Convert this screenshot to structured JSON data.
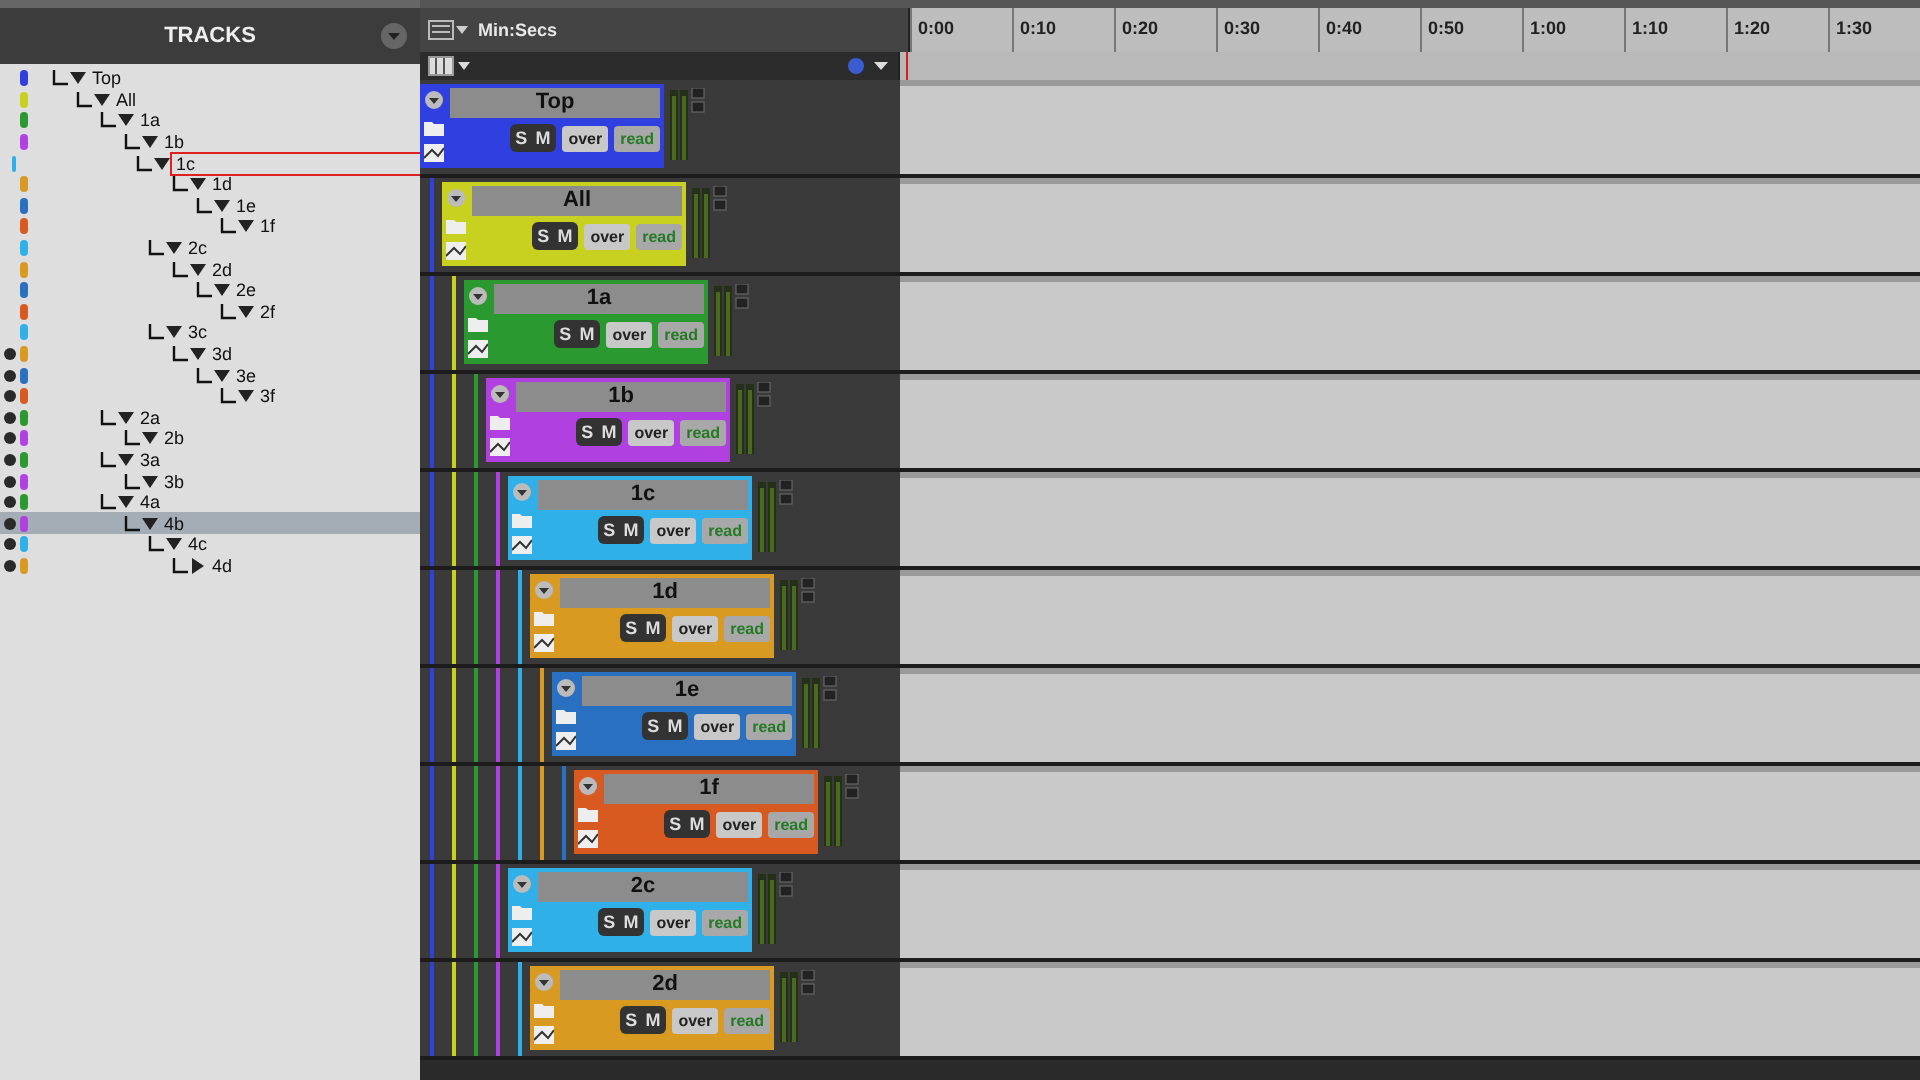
{
  "tracks_panel": {
    "title": "TRACKS",
    "tracks": [
      {
        "name": "Top",
        "color": "#3040e0",
        "shown": false,
        "expanded": true,
        "selected": false,
        "outlined": false,
        "children": [
          {
            "name": "All",
            "color": "#c8d020",
            "shown": false,
            "expanded": true,
            "selected": false,
            "outlined": false,
            "children": [
              {
                "name": "1a",
                "color": "#2a9a30",
                "shown": false,
                "expanded": true,
                "selected": false,
                "outlined": false,
                "children": [
                  {
                    "name": "1b",
                    "color": "#b040e0",
                    "shown": false,
                    "expanded": true,
                    "selected": false,
                    "outlined": false,
                    "children": [
                      {
                        "name": "1c",
                        "color": "#30b0e8",
                        "shown": false,
                        "expanded": true,
                        "selected": false,
                        "outlined": true,
                        "children": [
                          {
                            "name": "1d",
                            "color": "#d89a20",
                            "shown": false,
                            "expanded": true,
                            "selected": false,
                            "outlined": false,
                            "children": [
                              {
                                "name": "1e",
                                "color": "#2a70c0",
                                "shown": false,
                                "expanded": true,
                                "selected": false,
                                "outlined": false,
                                "children": [
                                  {
                                    "name": "1f",
                                    "color": "#d85a20",
                                    "shown": false,
                                    "expanded": true,
                                    "selected": false,
                                    "outlined": false
                                  }
                                ]
                              }
                            ]
                          }
                        ]
                      },
                      {
                        "name": "2c",
                        "color": "#30b0e8",
                        "shown": false,
                        "expanded": true,
                        "selected": false,
                        "outlined": false,
                        "children": [
                          {
                            "name": "2d",
                            "color": "#d89a20",
                            "shown": false,
                            "expanded": true,
                            "selected": false,
                            "outlined": false,
                            "children": [
                              {
                                "name": "2e",
                                "color": "#2a70c0",
                                "shown": false,
                                "expanded": true,
                                "selected": false,
                                "outlined": false,
                                "children": [
                                  {
                                    "name": "2f",
                                    "color": "#d85a20",
                                    "shown": false,
                                    "expanded": true,
                                    "selected": false,
                                    "outlined": false
                                  }
                                ]
                              }
                            ]
                          }
                        ]
                      },
                      {
                        "name": "3c",
                        "color": "#30b0e8",
                        "shown": false,
                        "expanded": true,
                        "selected": false,
                        "outlined": false,
                        "children": [
                          {
                            "name": "3d",
                            "color": "#d89a20",
                            "shown": true,
                            "expanded": true,
                            "selected": false,
                            "outlined": false,
                            "children": [
                              {
                                "name": "3e",
                                "color": "#2a70c0",
                                "shown": true,
                                "expanded": true,
                                "selected": false,
                                "outlined": false,
                                "children": [
                                  {
                                    "name": "3f",
                                    "color": "#d85a20",
                                    "shown": true,
                                    "expanded": true,
                                    "selected": false,
                                    "outlined": false
                                  }
                                ]
                              }
                            ]
                          }
                        ]
                      }
                    ]
                  }
                ]
              },
              {
                "name": "2a",
                "color": "#2a9a30",
                "shown": true,
                "expanded": true,
                "selected": false,
                "outlined": false,
                "children": [
                  {
                    "name": "2b",
                    "color": "#b040e0",
                    "shown": true,
                    "expanded": true,
                    "selected": false,
                    "outlined": false
                  }
                ]
              },
              {
                "name": "3a",
                "color": "#2a9a30",
                "shown": true,
                "expanded": true,
                "selected": false,
                "outlined": false,
                "children": [
                  {
                    "name": "3b",
                    "color": "#b040e0",
                    "shown": true,
                    "expanded": true,
                    "selected": false,
                    "outlined": false
                  }
                ]
              },
              {
                "name": "4a",
                "color": "#2a9a30",
                "shown": true,
                "expanded": true,
                "selected": false,
                "outlined": false,
                "children": [
                  {
                    "name": "4b",
                    "color": "#b040e0",
                    "shown": true,
                    "expanded": true,
                    "selected": true,
                    "outlined": false,
                    "children": [
                      {
                        "name": "4c",
                        "color": "#30b0e8",
                        "shown": true,
                        "expanded": true,
                        "selected": false,
                        "outlined": false,
                        "children": [
                          {
                            "name": "4d",
                            "color": "#d89a20",
                            "shown": true,
                            "expanded": false,
                            "selected": false,
                            "outlined": false
                          }
                        ]
                      }
                    ]
                  }
                ]
              }
            ]
          }
        ]
      }
    ]
  },
  "ruler": {
    "timebase": "Min:Secs",
    "ticks": [
      "0:00",
      "0:10",
      "0:20",
      "0:30",
      "0:40",
      "0:50",
      "1:00",
      "1:10",
      "1:20",
      "1:30"
    ]
  },
  "edit_window": {
    "tracks": [
      {
        "name": "Top",
        "color": "#3040e0",
        "solo": "S",
        "mute": "M",
        "voice": "over",
        "automation": "read",
        "children": [
          {
            "name": "All",
            "color": "#c8d020",
            "solo": "S",
            "mute": "M",
            "voice": "over",
            "automation": "read",
            "children": [
              {
                "name": "1a",
                "color": "#2a9a30",
                "solo": "S",
                "mute": "M",
                "voice": "over",
                "automation": "read",
                "children": [
                  {
                    "name": "1b",
                    "color": "#b040e0",
                    "solo": "S",
                    "mute": "M",
                    "voice": "over",
                    "automation": "read",
                    "children": [
                      {
                        "name": "1c",
                        "color": "#30b0e8",
                        "solo": "S",
                        "mute": "M",
                        "voice": "over",
                        "automation": "read",
                        "children": [
                          {
                            "name": "1d",
                            "color": "#d89a20",
                            "solo": "S",
                            "mute": "M",
                            "voice": "over",
                            "automation": "read",
                            "children": [
                              {
                                "name": "1e",
                                "color": "#2a70c0",
                                "solo": "S",
                                "mute": "M",
                                "voice": "over",
                                "automation": "read",
                                "children": [
                                  {
                                    "name": "1f",
                                    "color": "#d85a20",
                                    "solo": "S",
                                    "mute": "M",
                                    "voice": "over",
                                    "automation": "read"
                                  }
                                ]
                              }
                            ]
                          }
                        ]
                      },
                      {
                        "name": "2c",
                        "color": "#30b0e8",
                        "solo": "S",
                        "mute": "M",
                        "voice": "over",
                        "automation": "read",
                        "children": [
                          {
                            "name": "2d",
                            "color": "#d89a20",
                            "solo": "S",
                            "mute": "M",
                            "voice": "over",
                            "automation": "read"
                          }
                        ]
                      }
                    ]
                  }
                ]
              }
            ]
          }
        ]
      }
    ]
  }
}
